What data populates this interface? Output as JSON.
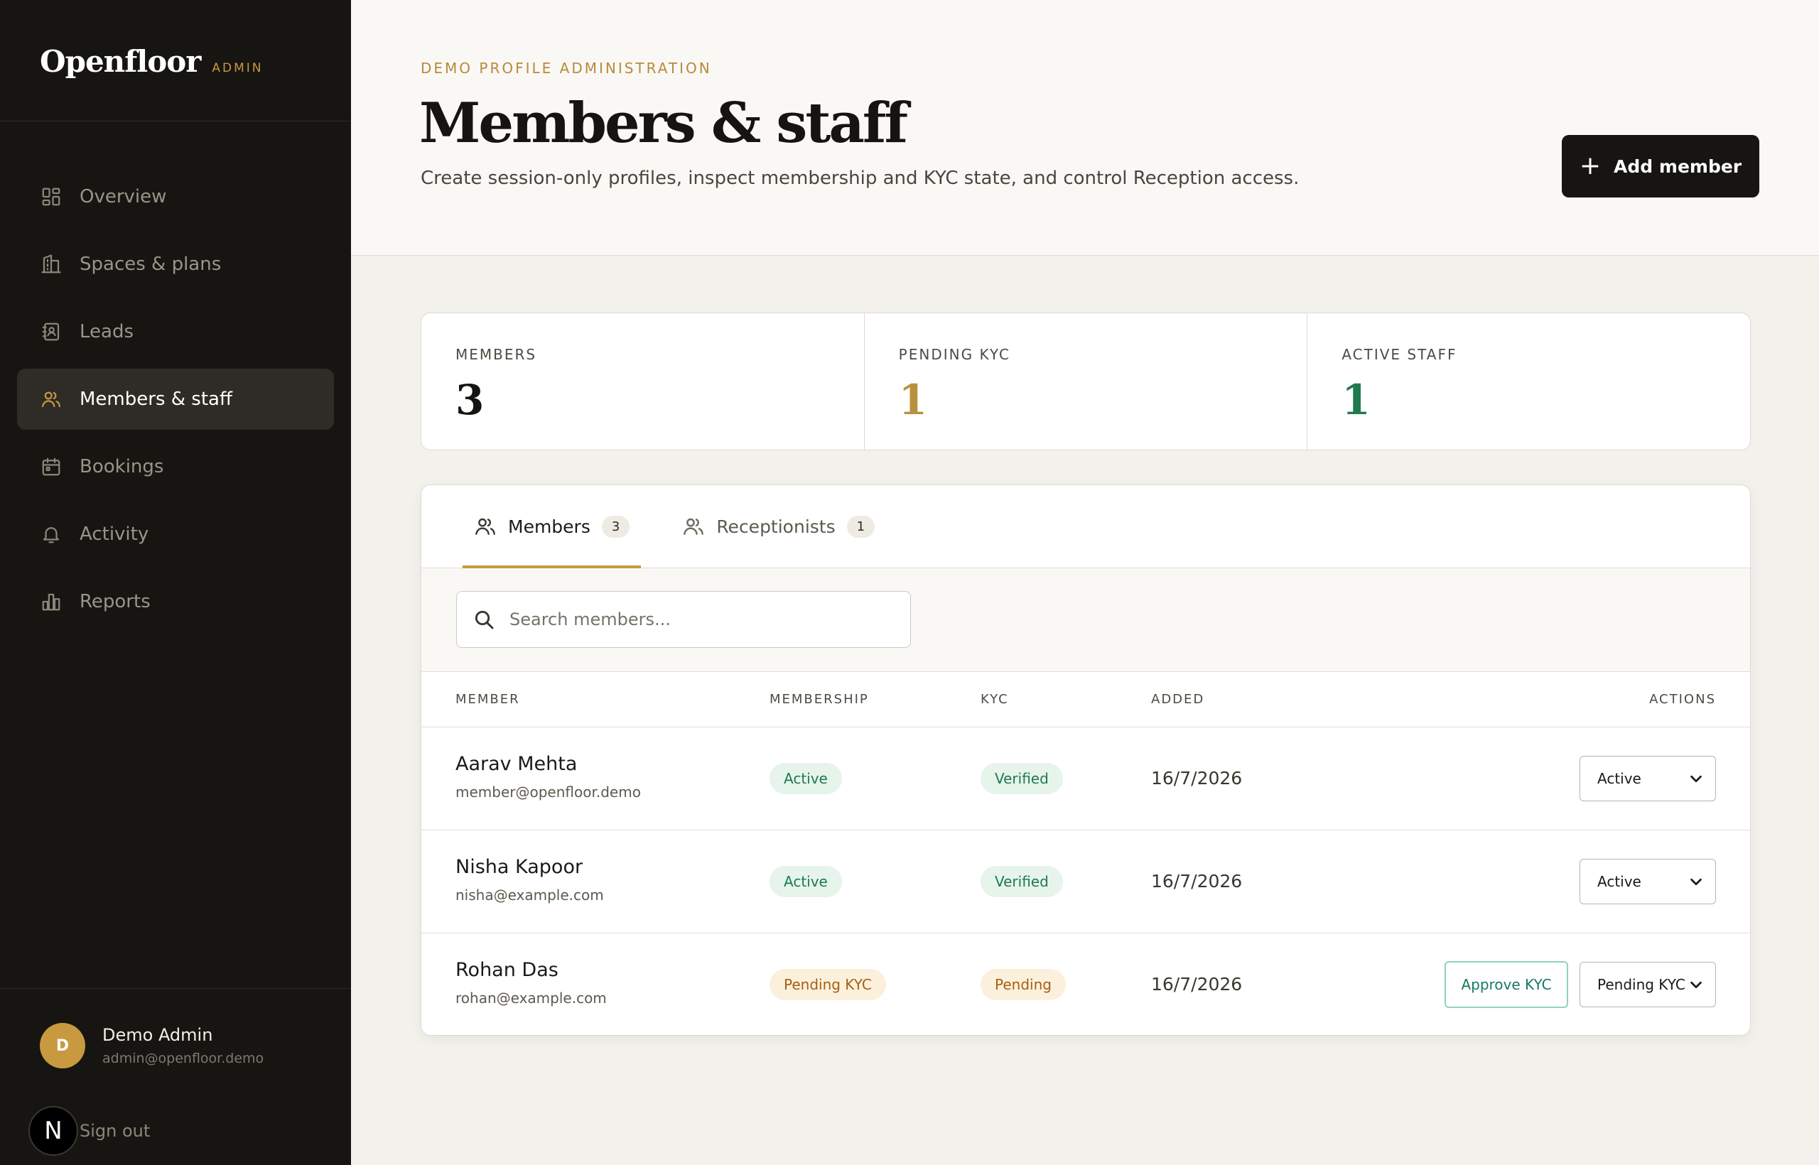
{
  "brand": {
    "name": "Openfloor",
    "tag": "ADMIN"
  },
  "nav": [
    {
      "label": "Overview",
      "icon": "grid-icon",
      "active": false
    },
    {
      "label": "Spaces & plans",
      "icon": "building-icon",
      "active": false
    },
    {
      "label": "Leads",
      "icon": "contact-book-icon",
      "active": false
    },
    {
      "label": "Members & staff",
      "icon": "users-icon",
      "active": true
    },
    {
      "label": "Bookings",
      "icon": "calendar-icon",
      "active": false
    },
    {
      "label": "Activity",
      "icon": "bell-icon",
      "active": false
    },
    {
      "label": "Reports",
      "icon": "bar-chart-icon",
      "active": false
    }
  ],
  "user": {
    "initial": "D",
    "name": "Demo Admin",
    "email": "admin@openfloor.demo",
    "signout": "Sign out",
    "badge": "N"
  },
  "header": {
    "eyebrow": "DEMO PROFILE ADMINISTRATION",
    "title": "Members & staff",
    "subtitle": "Create session-only profiles, inspect membership and KYC state, and control Reception access.",
    "add_button": "Add member"
  },
  "stats": [
    {
      "label": "MEMBERS",
      "value": "3",
      "color": "#161411"
    },
    {
      "label": "PENDING KYC",
      "value": "1",
      "color": "#b8913f"
    },
    {
      "label": "ACTIVE STAFF",
      "value": "1",
      "color": "#1f7a4d"
    }
  ],
  "tabs": [
    {
      "label": "Members",
      "count": "3",
      "active": true
    },
    {
      "label": "Receptionists",
      "count": "1",
      "active": false
    }
  ],
  "search": {
    "placeholder": "Search members..."
  },
  "table": {
    "headers": {
      "member": "MEMBER",
      "membership": "MEMBERSHIP",
      "kyc": "KYC",
      "added": "ADDED",
      "actions": "ACTIONS"
    },
    "rows": [
      {
        "name": "Aarav Mehta",
        "email": "member@openfloor.demo",
        "membership": "Active",
        "membership_tone": "green",
        "kyc": "Verified",
        "kyc_tone": "green",
        "added": "16/7/2026",
        "status": "Active",
        "approve": ""
      },
      {
        "name": "Nisha Kapoor",
        "email": "nisha@example.com",
        "membership": "Active",
        "membership_tone": "green",
        "kyc": "Verified",
        "kyc_tone": "green",
        "added": "16/7/2026",
        "status": "Active",
        "approve": ""
      },
      {
        "name": "Rohan Das",
        "email": "rohan@example.com",
        "membership": "Pending KYC",
        "membership_tone": "amber",
        "kyc": "Pending",
        "kyc_tone": "amber",
        "added": "16/7/2026",
        "status": "Pending KYC",
        "approve": "Approve KYC"
      }
    ]
  }
}
